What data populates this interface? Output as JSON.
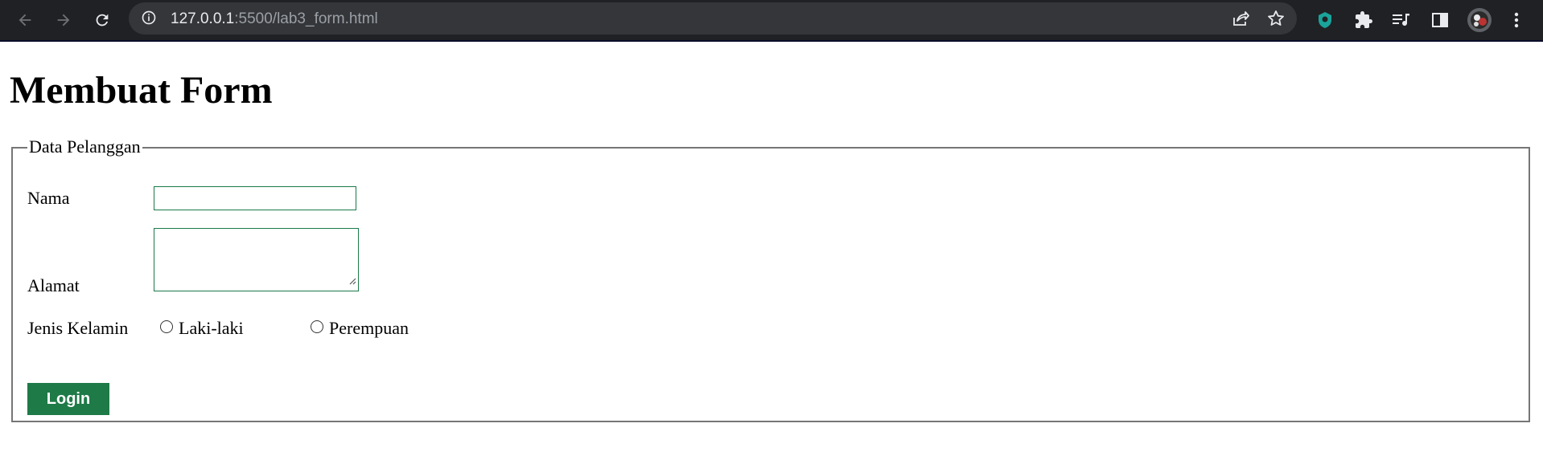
{
  "browser": {
    "url_host": "127.0.0.1",
    "url_path": ":5500/lab3_form.html",
    "icons": [
      "back-arrow-icon",
      "forward-arrow-icon",
      "reload-icon",
      "info-icon",
      "share-icon",
      "star-icon",
      "extension-icon",
      "puzzle-icon",
      "reading-list-icon",
      "side-panel-icon",
      "avatar",
      "more-menu-icon"
    ]
  },
  "page": {
    "title": "Membuat Form",
    "fieldset_legend": "Data Pelanggan",
    "fields": {
      "nama_label": "Nama",
      "nama_value": "",
      "alamat_label": "Alamat",
      "alamat_value": "",
      "gender_label": "Jenis Kelamin",
      "gender_options": [
        "Laki-laki",
        "Perempuan"
      ],
      "gender_selected": null
    },
    "submit_label": "Login",
    "colors": {
      "button_bg": "#1e7a47",
      "input_border": "#1a7a4a",
      "toolbar_bg": "#202124"
    }
  }
}
